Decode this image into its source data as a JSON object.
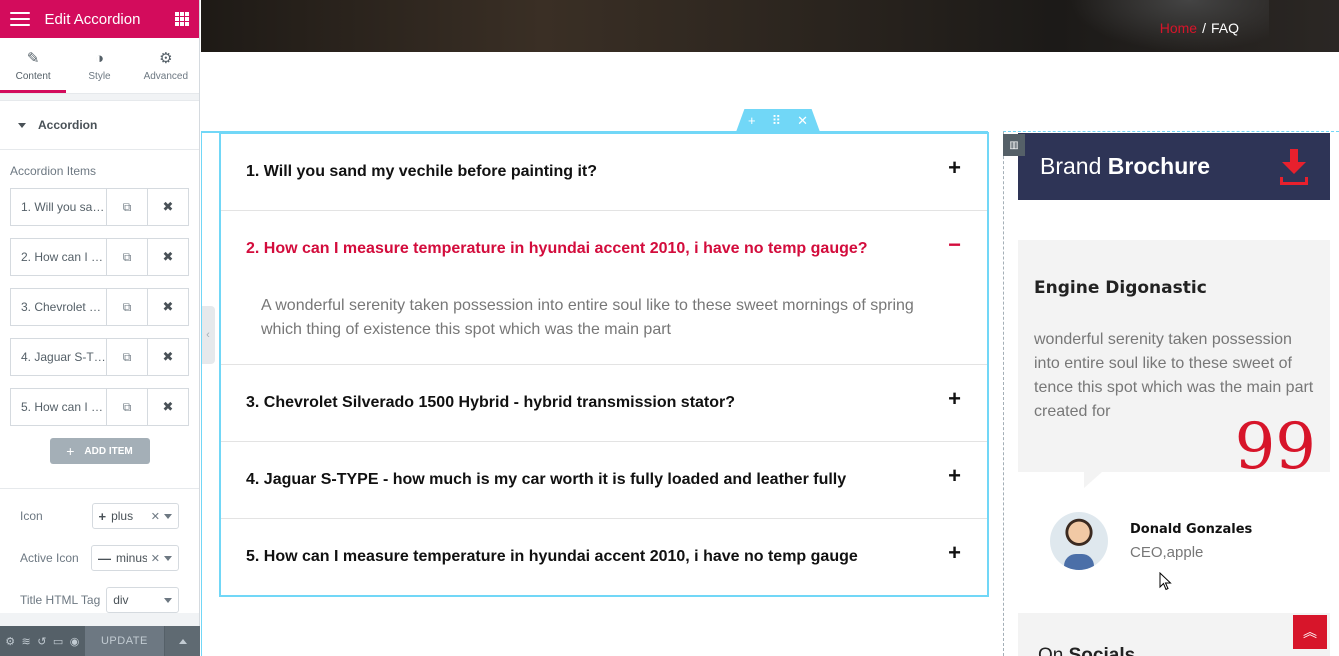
{
  "panel": {
    "title": "Edit Accordion",
    "tabs": [
      {
        "label": "Content",
        "icon": "pencil-icon"
      },
      {
        "label": "Style",
        "icon": "contrast-icon"
      },
      {
        "label": "Advanced",
        "icon": "gear-icon"
      }
    ],
    "section_title": "Accordion",
    "items_label": "Accordion Items",
    "items": [
      {
        "label": "1. Will you sand my vechile before painting it?"
      },
      {
        "label": "2. How can I measure temperature in hyundai accent 2010, i have no temp gauge?"
      },
      {
        "label": "3. Chevrolet Silverado 1500 Hybrid - hybrid transmission stator?"
      },
      {
        "label": "4. Jaguar S-TYPE - how much is my car worth it is fully loaded and leather fully"
      },
      {
        "label": "5. How can I measure temperature in hyundai accent 2010, i have no temp gauge"
      }
    ],
    "add_item_label": "ADD ITEM",
    "icon_label": "Icon",
    "icon_value": "plus",
    "icon_symbol": "+",
    "active_icon_label": "Active Icon",
    "active_icon_value": "minus",
    "active_icon_symbol": "—",
    "title_tag_label": "Title HTML Tag",
    "title_tag_value": "div",
    "update_label": "UPDATE"
  },
  "breadcrumb": {
    "home": "Home",
    "sep": "/",
    "current": "FAQ"
  },
  "accordion": [
    {
      "title": "1. Will you sand my vechile before painting it?",
      "icon": "+"
    },
    {
      "title": "2. How can I measure temperature in hyundai accent 2010, i have no temp gauge?",
      "icon": "−",
      "content": "A wonderful serenity taken possession into entire soul like to these sweet mornings of spring which thing of existence this spot which was the main part"
    },
    {
      "title": "3. Chevrolet Silverado 1500 Hybrid - hybrid transmission stator?",
      "icon": "+"
    },
    {
      "title": "4. Jaguar S-TYPE - how much is my car worth it is fully loaded and leather fully",
      "icon": "+"
    },
    {
      "title": "5. How can I measure temperature in hyundai accent 2010, i have no temp gauge",
      "icon": "+"
    }
  ],
  "sidebar": {
    "brochure_light": "Brand ",
    "brochure_bold": "Brochure",
    "testimonial_title": "Engine Digonastic",
    "testimonial_text": "wonderful serenity taken possession into entire soul like to these sweet of tence this spot which was the main part created for",
    "quote_mark": "99",
    "author_name": "Donald Gonzales",
    "author_role": "CEO,apple",
    "socials_light": "On ",
    "socials_bold": "Socials"
  },
  "colors": {
    "brand": "#d30c5c",
    "accent_red": "#d7152a",
    "editor_blue": "#71d7f7",
    "brochure_bg": "#2e3456"
  }
}
